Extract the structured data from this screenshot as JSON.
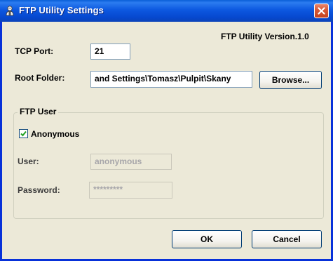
{
  "window": {
    "title": "FTP Utility Settings"
  },
  "version_text": "FTP Utility Version.1.0",
  "tcp_port": {
    "label": "TCP Port:",
    "value": "21"
  },
  "root_folder": {
    "label": "Root Folder:",
    "value": "and Settings\\Tomasz\\Pulpit\\Skany",
    "browse_label": "Browse..."
  },
  "ftp_user": {
    "group_label": "FTP User",
    "anonymous_label": "Anonymous",
    "anonymous_checked": true,
    "user_label": "User:",
    "user_value": "anonymous",
    "password_label": "Password:",
    "password_value": "*********"
  },
  "buttons": {
    "ok_label": "OK",
    "cancel_label": "Cancel"
  },
  "icons": {
    "title_icon": "ftp-app-icon",
    "close_icon": "close-icon",
    "check_icon": "checkmark-icon"
  }
}
